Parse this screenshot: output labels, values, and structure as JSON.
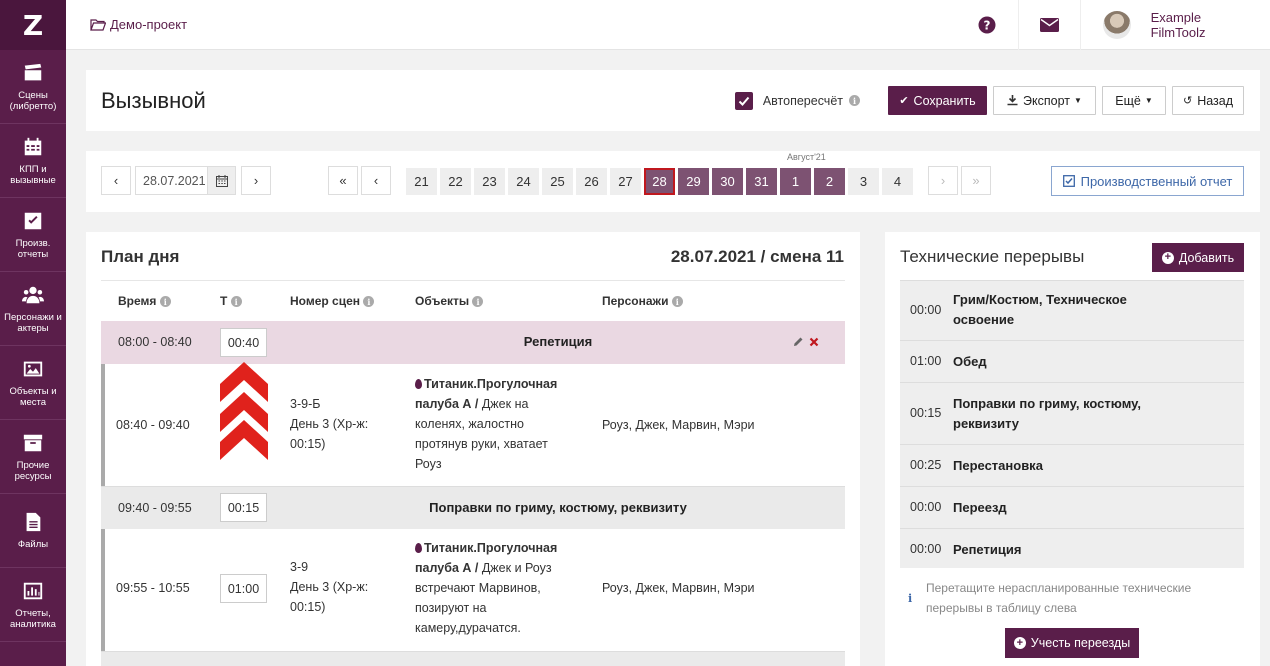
{
  "sidebar": {
    "logo": "Z",
    "items": [
      {
        "label": "Сцены (либретто)",
        "icon": "clapperboard-icon"
      },
      {
        "label": "КПП и вызывные",
        "icon": "calendar-icon"
      },
      {
        "label": "Произв. отчеты",
        "icon": "checkbox-icon"
      },
      {
        "label": "Персонажи и актеры",
        "icon": "users-icon"
      },
      {
        "label": "Объекты и места",
        "icon": "image-icon"
      },
      {
        "label": "Прочие ресурсы",
        "icon": "archive-icon"
      },
      {
        "label": "Файлы",
        "icon": "file-icon"
      },
      {
        "label": "Отчеты, аналитика",
        "icon": "chart-icon"
      }
    ]
  },
  "topbar": {
    "breadcrumb": "Демо-проект",
    "user_name": "Example FilmToolz"
  },
  "header": {
    "title": "Вызывной",
    "auto_recalc_label": "Автопересчёт",
    "auto_recalc_checked": true,
    "save_label": "Сохранить",
    "export_label": "Экспорт",
    "more_label": "Ещё",
    "back_label": "Назад"
  },
  "datenav": {
    "prev": "‹",
    "next": "›",
    "date_value": "28.07.2021",
    "first": "«",
    "last": "»",
    "month_label": "Август'21",
    "days": [
      "21",
      "22",
      "23",
      "24",
      "25",
      "26",
      "27",
      "28",
      "29",
      "30",
      "31",
      "1",
      "2",
      "3",
      "4"
    ],
    "selected_day": "28",
    "report_label": "Производственный отчет"
  },
  "plan": {
    "title": "План дня",
    "date_shift": "28.07.2021 / смена 11",
    "columns": [
      "Время",
      "Т",
      "Номер сцен",
      "Объекты",
      "Персонажи"
    ],
    "rows": [
      {
        "type": "rehearsal",
        "time": "08:00 - 08:40",
        "duration": "00:40",
        "label": "Репетиция"
      },
      {
        "type": "scene",
        "time": "08:40 - 09:40",
        "scene_no": "3-9-Б",
        "scene_day": "День 3 (Хр-ж: 00:15)",
        "object_bold": "Титаник.Прогулочная палуба А /",
        "object_desc": "Джек на коленях, жалостно протянув руки, хватает Роуз",
        "characters": "Роуз, Джек, Марвин, Мэри"
      },
      {
        "type": "break",
        "time": "09:40 - 09:55",
        "duration": "00:15",
        "label": "Поправки по гриму, костюму, реквизиту"
      },
      {
        "type": "scene",
        "time": "09:55 - 10:55",
        "duration": "01:00",
        "scene_no": "3-9",
        "scene_day": "День 3 (Хр-ж: 00:15)",
        "object_bold": "Титаник.Прогулочная палуба А /",
        "object_desc": "Джек и Роуз встречают Марвинов, позируют на камеру,дурачатся.",
        "characters": "Роуз, Джек, Марвин, Мэри"
      }
    ]
  },
  "tech": {
    "title": "Технические перерывы",
    "add_label": "Добавить",
    "items": [
      {
        "time": "00:00",
        "name": "Грим/Костюм, Техническое освоение"
      },
      {
        "time": "01:00",
        "name": "Обед"
      },
      {
        "time": "00:15",
        "name": "Поправки по гриму, костюму, реквизиту"
      },
      {
        "time": "00:25",
        "name": "Перестановка"
      },
      {
        "time": "00:00",
        "name": "Переезд"
      },
      {
        "time": "00:00",
        "name": "Репетиция"
      }
    ],
    "hint": "Перетащите нераспланированные технические перерывы в таблицу слева",
    "moves_label": "Учесть переезды"
  }
}
